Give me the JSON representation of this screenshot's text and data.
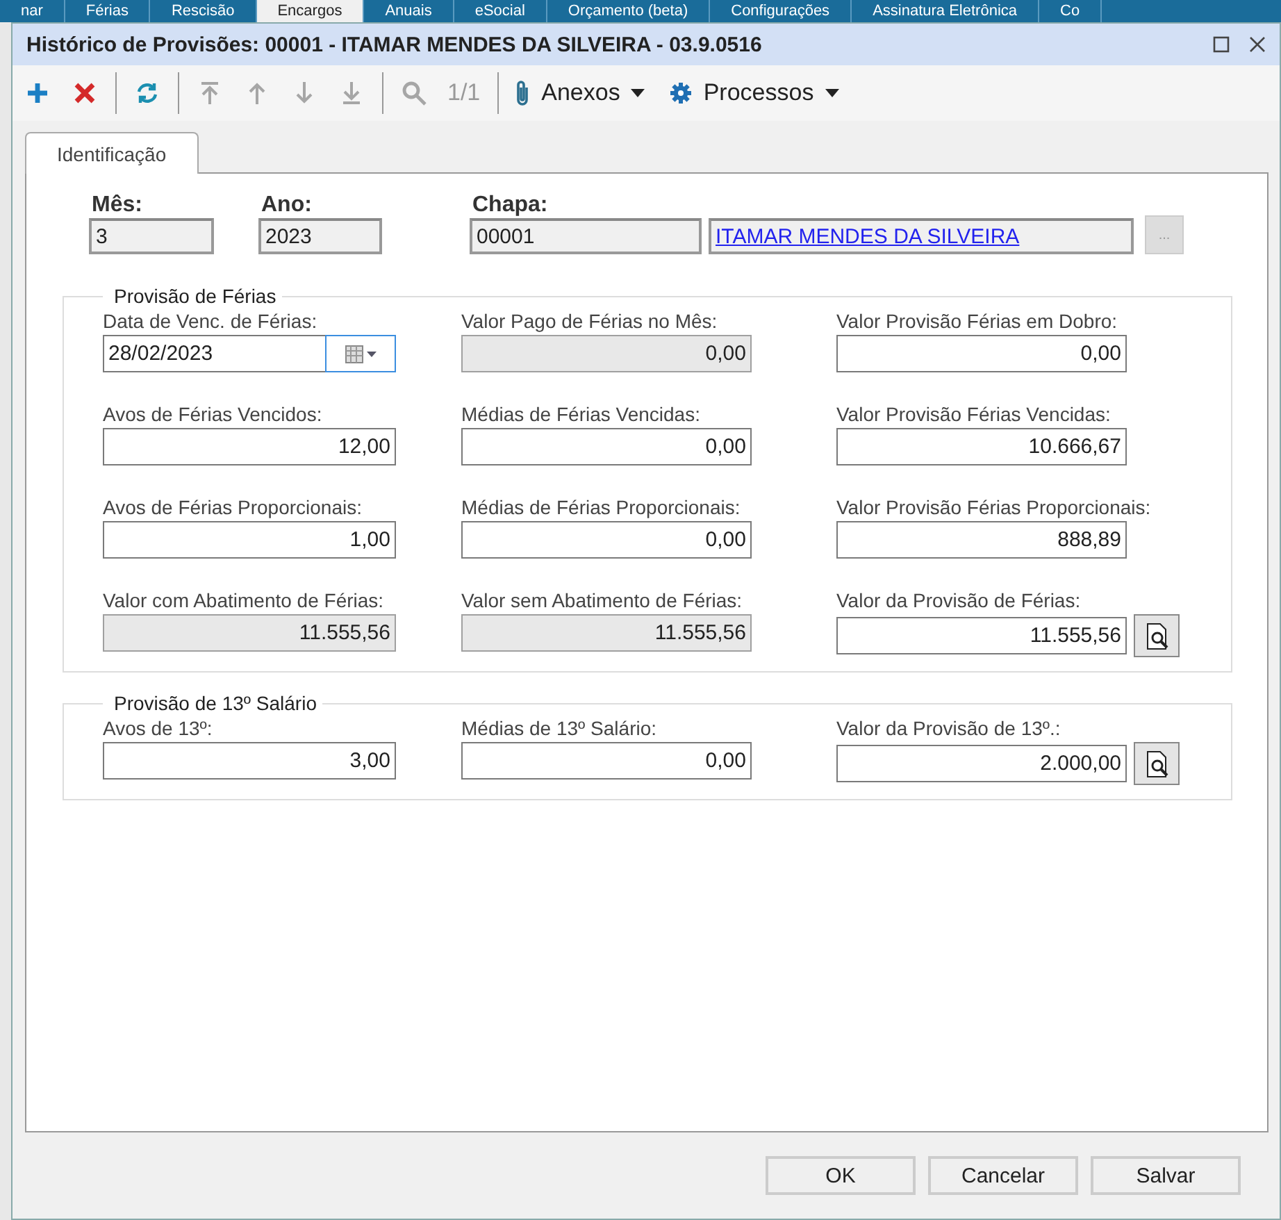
{
  "background_menu": [
    {
      "label": "nar",
      "selected": false
    },
    {
      "label": "Férias",
      "selected": false
    },
    {
      "label": "Rescisão",
      "selected": false
    },
    {
      "label": "Encargos",
      "selected": true
    },
    {
      "label": "Anuais",
      "selected": false
    },
    {
      "label": "eSocial",
      "selected": false
    },
    {
      "label": "Orçamento (beta)",
      "selected": false
    },
    {
      "label": "Configurações",
      "selected": false
    },
    {
      "label": "Assinatura Eletrônica",
      "selected": false
    },
    {
      "label": "Co",
      "selected": false
    }
  ],
  "window": {
    "title": "Histórico de Provisões: 00001 - ITAMAR MENDES DA SILVEIRA - 03.9.0516"
  },
  "toolbar": [
    {
      "kind": "add",
      "disabled": false
    },
    {
      "kind": "delete",
      "disabled": false
    },
    {
      "kind": "separator"
    },
    {
      "kind": "refresh",
      "disabled": false
    },
    {
      "kind": "separator"
    },
    {
      "kind": "first",
      "disabled": true
    },
    {
      "kind": "prev",
      "disabled": true
    },
    {
      "kind": "next",
      "disabled": true
    },
    {
      "kind": "last",
      "disabled": true
    },
    {
      "kind": "separator"
    },
    {
      "kind": "search",
      "disabled": true
    },
    {
      "kind": "counter",
      "text": "1/1",
      "disabled": true
    },
    {
      "kind": "separator"
    },
    {
      "kind": "attach",
      "label": "Anexos",
      "disabled": false
    },
    {
      "kind": "process",
      "label": "Processos",
      "disabled": false
    }
  ],
  "tabs": [
    {
      "label": "Identificação",
      "selected": true
    }
  ],
  "header": {
    "fields": [
      {
        "label": "Mês:",
        "value": "3"
      },
      {
        "label": "Ano:",
        "value": "2023"
      },
      {
        "label": "Chapa:",
        "value": "00001"
      }
    ],
    "employee_link": "ITAMAR MENDES DA SILVEIRA",
    "browse_button": {
      "label": "...",
      "disabled": true
    }
  },
  "groups": [
    {
      "title": "Provisão de Férias",
      "fields": [
        {
          "label": "Data de Venc. de Férias:",
          "value": "28/02/2023",
          "kind": "date",
          "disabled": false
        },
        {
          "label": "Valor Pago de Férias no Mês:",
          "value": "0,00",
          "kind": "number",
          "disabled": true,
          "lookup": false
        },
        {
          "label": "Valor Provisão Férias em Dobro:",
          "value": "0,00",
          "kind": "number",
          "disabled": false,
          "lookup": false
        },
        {
          "label": "Avos de Férias Vencidos:",
          "value": "12,00",
          "kind": "number",
          "disabled": false,
          "lookup": false
        },
        {
          "label": "Médias de Férias Vencidas:",
          "value": "0,00",
          "kind": "number",
          "disabled": false,
          "lookup": false
        },
        {
          "label": "Valor Provisão Férias Vencidas:",
          "value": "10.666,67",
          "kind": "number",
          "disabled": false,
          "lookup": false
        },
        {
          "label": "Avos de Férias Proporcionais:",
          "value": "1,00",
          "kind": "number",
          "disabled": false,
          "lookup": false
        },
        {
          "label": "Médias de Férias Proporcionais:",
          "value": "0,00",
          "kind": "number",
          "disabled": false,
          "lookup": false
        },
        {
          "label": "Valor Provisão Férias Proporcionais:",
          "value": "888,89",
          "kind": "number",
          "disabled": false,
          "lookup": false
        },
        {
          "label": "Valor com Abatimento de Férias:",
          "value": "11.555,56",
          "kind": "number",
          "disabled": true,
          "lookup": false
        },
        {
          "label": "Valor sem Abatimento de Férias:",
          "value": "11.555,56",
          "kind": "number",
          "disabled": true,
          "lookup": false
        },
        {
          "label": "Valor da Provisão de Férias:",
          "value": "11.555,56",
          "kind": "number",
          "disabled": false,
          "lookup": true
        }
      ]
    },
    {
      "title": "Provisão de 13º Salário",
      "fields": [
        {
          "label": "Avos de 13º:",
          "value": "3,00",
          "kind": "number",
          "disabled": false,
          "lookup": false
        },
        {
          "label": "Médias de 13º Salário:",
          "value": "0,00",
          "kind": "number",
          "disabled": false,
          "lookup": false
        },
        {
          "label": "Valor da Provisão de 13º.:",
          "value": "2.000,00",
          "kind": "number",
          "disabled": false,
          "lookup": true
        }
      ]
    }
  ],
  "buttons": [
    "OK",
    "Cancelar",
    "Salvar"
  ]
}
